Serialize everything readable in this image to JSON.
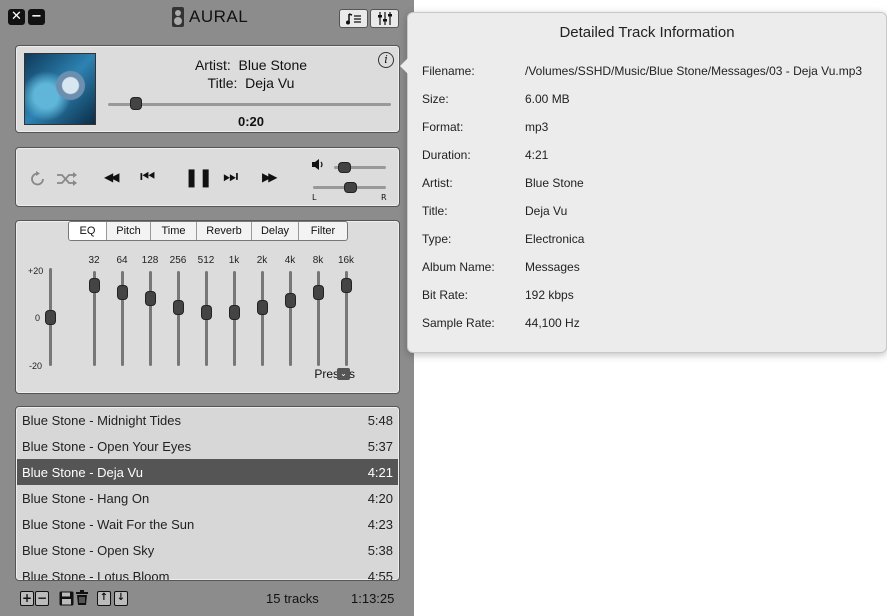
{
  "app": {
    "title": "AURAL",
    "close_glyph": "✕",
    "minimize_glyph": "−",
    "playlist_button_icon": "playlist-icon",
    "effects_button_icon": "equalizer-sliders-icon"
  },
  "now_playing": {
    "artist_label": "Artist:",
    "artist": "Blue Stone",
    "title_label": "Title:",
    "title": "Deja Vu",
    "position": "0:20",
    "seek_fraction": 0.1,
    "info_glyph": "i"
  },
  "controls": {
    "repeat_icon": "repeat-icon",
    "shuffle_icon": "shuffle-icon",
    "seek_back_glyph": "◀◀",
    "prev_glyph": "⏮",
    "pause_glyph": "❚❚",
    "next_glyph": "⏭",
    "seek_forward_glyph": "▶▶",
    "volume_fraction": 0.2,
    "balance_fraction": 0.5,
    "balance_left_label": "L",
    "balance_right_label": "R"
  },
  "effects": {
    "tabs": [
      "EQ",
      "Pitch",
      "Time",
      "Reverb",
      "Delay",
      "Filter"
    ],
    "active_tab": "EQ",
    "db_labels": {
      "top": "+20",
      "mid": "0",
      "bottom": "-20"
    },
    "preamp_level": 0.5,
    "bands": [
      {
        "label": "32",
        "level": 0.85
      },
      {
        "label": "64",
        "level": 0.78
      },
      {
        "label": "128",
        "level": 0.72
      },
      {
        "label": "256",
        "level": 0.62
      },
      {
        "label": "512",
        "level": 0.57
      },
      {
        "label": "1k",
        "level": 0.57
      },
      {
        "label": "2k",
        "level": 0.62
      },
      {
        "label": "4k",
        "level": 0.7
      },
      {
        "label": "8k",
        "level": 0.78
      },
      {
        "label": "16k",
        "level": 0.85
      }
    ],
    "presets_label": "Presets"
  },
  "playlist": {
    "rows": [
      {
        "name": "Blue Stone - Midnight Tides",
        "duration": "5:48",
        "selected": false
      },
      {
        "name": "Blue Stone - Open Your Eyes",
        "duration": "5:37",
        "selected": false
      },
      {
        "name": "Blue Stone - Deja Vu",
        "duration": "4:21",
        "selected": true
      },
      {
        "name": "Blue Stone - Hang On",
        "duration": "4:20",
        "selected": false
      },
      {
        "name": "Blue Stone - Wait For the Sun",
        "duration": "4:23",
        "selected": false
      },
      {
        "name": "Blue Stone - Open Sky",
        "duration": "5:38",
        "selected": false
      },
      {
        "name": "Blue Stone - Lotus Bloom",
        "duration": "4:55",
        "selected": false
      }
    ],
    "track_count": "15 tracks",
    "total_duration": "1:13:25"
  },
  "track_info": {
    "heading": "Detailed Track Information",
    "fields": [
      {
        "key": "Filename:",
        "value": "/Volumes/SSHD/Music/Blue Stone/Messages/03 - Deja Vu.mp3"
      },
      {
        "key": "Size:",
        "value": "6.00 MB"
      },
      {
        "key": "Format:",
        "value": "mp3"
      },
      {
        "key": "Duration:",
        "value": "4:21"
      },
      {
        "key": "Artist:",
        "value": "Blue Stone"
      },
      {
        "key": "Title:",
        "value": "Deja Vu"
      },
      {
        "key": "Type:",
        "value": "Electronica"
      },
      {
        "key": "Album Name:",
        "value": "Messages"
      },
      {
        "key": "Bit Rate:",
        "value": "192 kbps"
      },
      {
        "key": "Sample Rate:",
        "value": "44,100 Hz"
      }
    ]
  },
  "colors": {
    "app_background": "#8c8c8c",
    "panel": "#dcdcdc",
    "selected_row": "#555555",
    "popover": "#ececec"
  }
}
